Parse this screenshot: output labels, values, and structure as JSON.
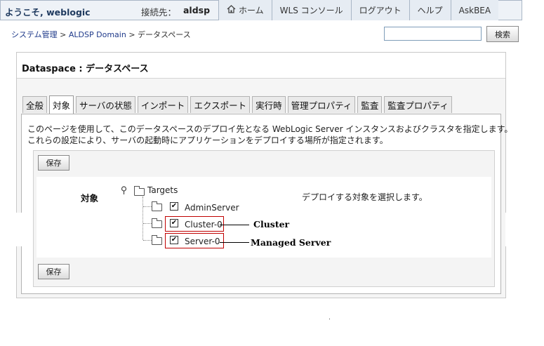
{
  "header": {
    "welcome": "ようこそ, weblogic",
    "connection_label": "接続先：",
    "connection_value": "aldsp",
    "nav": [
      {
        "label": "ホーム",
        "icon": "home-icon"
      },
      {
        "label": "WLS コンソール"
      },
      {
        "label": "ログアウト"
      },
      {
        "label": "ヘルプ"
      },
      {
        "label": "AskBEA"
      }
    ]
  },
  "breadcrumb": {
    "root": "システム管理",
    "sep": ">",
    "domain": "ALDSP Domain",
    "current": "データスペース"
  },
  "search": {
    "value": "",
    "button_label": "検索"
  },
  "page": {
    "title": "Dataspace : データスペース"
  },
  "tabs": [
    {
      "label": "全般",
      "active": false
    },
    {
      "label": "対象",
      "active": true
    },
    {
      "label": "サーバの状態",
      "active": false
    },
    {
      "label": "インポート",
      "active": false
    },
    {
      "label": "エクスポート",
      "active": false
    },
    {
      "label": "実行時",
      "active": false
    },
    {
      "label": "管理プロパティ",
      "active": false
    },
    {
      "label": "監査",
      "active": false
    },
    {
      "label": "監査プロパティ",
      "active": false
    }
  ],
  "description": {
    "line1": "このページを使用して、このデータスペースのデプロイ先となる WebLogic Server インスタンスおよびクラスタを指定します。",
    "line2": "これらの設定により、サーバの起動時にアプリケーションをデプロイする場所が指定されます。"
  },
  "form": {
    "save_label": "保存",
    "targets_label": "対象",
    "instruction": "デプロイする対象を選択します。",
    "tree": {
      "root_label": "Targets",
      "items": [
        {
          "label": "AdminServer",
          "checked": true
        },
        {
          "label": "Cluster-0",
          "checked": true
        },
        {
          "label": "Server-0",
          "checked": true
        }
      ]
    }
  },
  "annotations": {
    "cluster": "Cluster",
    "managed_server": "Managed Server"
  },
  "check_glyph": "✔"
}
